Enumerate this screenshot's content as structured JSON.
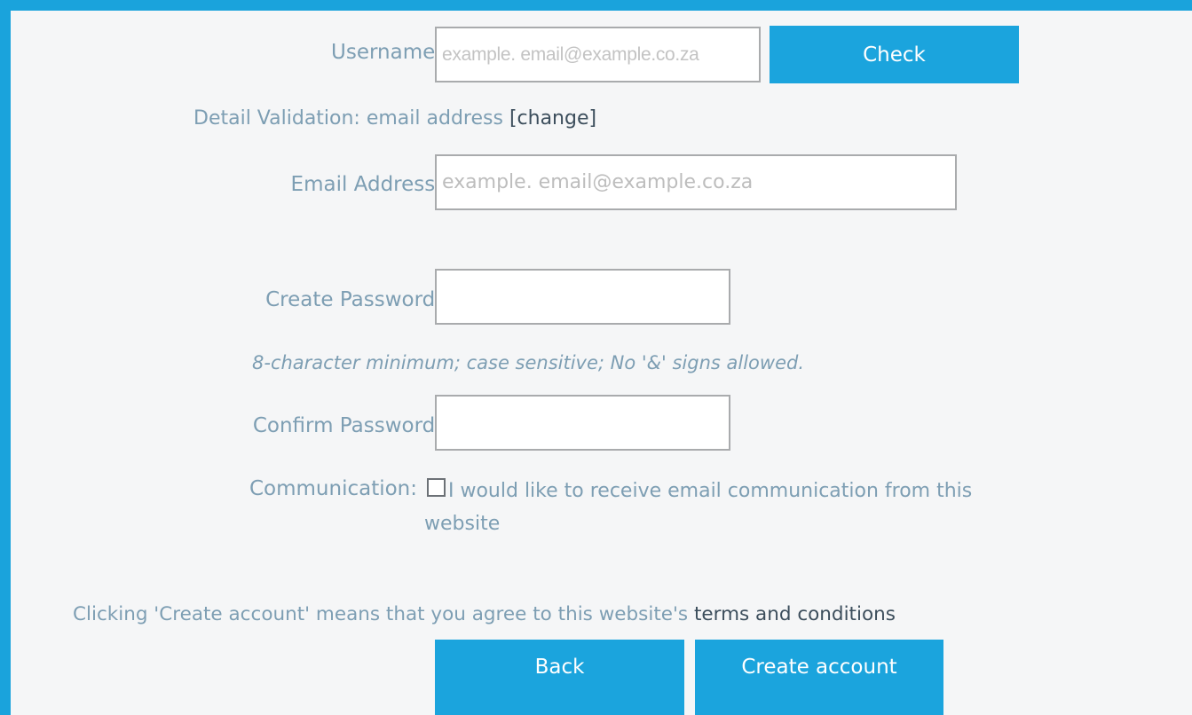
{
  "colors": {
    "frame": "#1aa3dc",
    "button": "#1ba4dd",
    "label": "#7d9eb3",
    "link": "#3c4e5c"
  },
  "username": {
    "label": "Username:",
    "placeholder": "example. email@example.co.za",
    "check_button": "Check"
  },
  "validation": {
    "text": "Detail Validation: email address",
    "change_link": "[change]"
  },
  "email": {
    "label": "Email Address:",
    "placeholder": "example. email@example.co.za"
  },
  "create_password": {
    "label": "Create Password:",
    "value": "",
    "hint": "8-character minimum; case sensitive; No '&' signs allowed."
  },
  "confirm_password": {
    "label": "Confirm Password:",
    "value": ""
  },
  "communication": {
    "label": "Communication:",
    "checkbox_checked": false,
    "checkbox_icon": "checkbox-empty",
    "checkbox_text_line1": "I would like to receive email communication from this",
    "checkbox_text_line2": "website"
  },
  "terms": {
    "text": "Clicking 'Create account' means that you agree to this website's",
    "link": "terms and conditions"
  },
  "actions": {
    "back": "Back",
    "create_account": "Create account"
  }
}
